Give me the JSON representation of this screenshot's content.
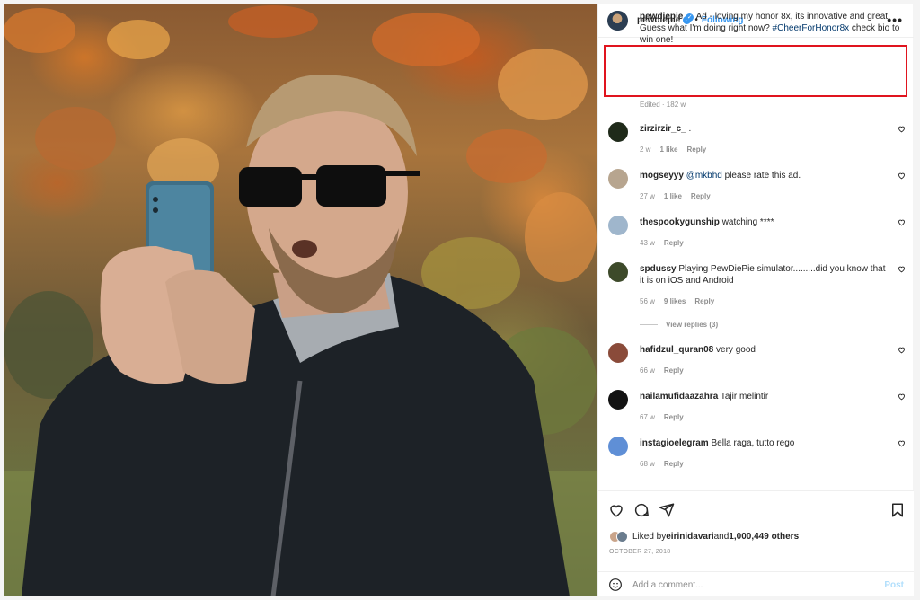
{
  "header": {
    "username": "pewdiepie",
    "verified_icon": "verified-badge-icon",
    "separator": "•",
    "following_label": "Following",
    "more_icon": "more-options-icon",
    "more_glyph": "•••"
  },
  "caption": {
    "username": "pewdiepie",
    "text": "Ad - loving my honor 8x, its innovative and great. Guess what I'm doing right now?",
    "hashtag": "#CheerForHonor8x",
    "text_after": " check bio to win one!",
    "meta": "Edited · 182 w",
    "highlight_color": "#e0141e"
  },
  "comments": [
    {
      "username": "zirzirzir_c_",
      "text": ".",
      "age": "2 w",
      "likes": "1 like",
      "reply": "Reply",
      "avatar_color": "#1f2a1a"
    },
    {
      "username": "mogseyyy",
      "mention": "@mkbhd",
      "text": " please rate this ad.",
      "age": "27 w",
      "likes": "1 like",
      "reply": "Reply",
      "avatar_color": "#b7a58f"
    },
    {
      "username": "thespookygunship",
      "text": "watching ****",
      "age": "43 w",
      "likes": "",
      "reply": "Reply",
      "avatar_color": "#9fb6cc"
    },
    {
      "username": "spdussy",
      "text": "Playing PewDiePie simulator.........did you know that it is on iOS and Android",
      "age": "56 w",
      "likes": "9 likes",
      "reply": "Reply",
      "avatar_color": "#3d4a2a"
    },
    {
      "username": "hafidzul_quran08",
      "text": "very good",
      "age": "66 w",
      "likes": "",
      "reply": "Reply",
      "avatar_color": "#8a4b3a"
    },
    {
      "username": "nailamufidaazahra",
      "text": "Tajir melintir",
      "age": "67 w",
      "likes": "",
      "reply": "Reply",
      "avatar_color": "#121212"
    },
    {
      "username": "instagioelegram",
      "text": "Bella raga, tutto rego",
      "age": "68 w",
      "likes": "",
      "reply": "Reply",
      "avatar_color": "#5f8fd6"
    }
  ],
  "view_replies": "View replies (3)",
  "actions": {
    "like_icon": "heart-icon",
    "comment_icon": "comment-icon",
    "share_icon": "share-icon",
    "save_icon": "bookmark-icon"
  },
  "likes": {
    "prefix": "Liked by ",
    "user": "eirinidavari",
    "middle": " and ",
    "count": "1,000,449 others"
  },
  "date": "OCTOBER 27, 2018",
  "add_comment": {
    "placeholder": "Add a comment...",
    "post_label": "Post",
    "emoji_icon": "emoji-icon"
  }
}
